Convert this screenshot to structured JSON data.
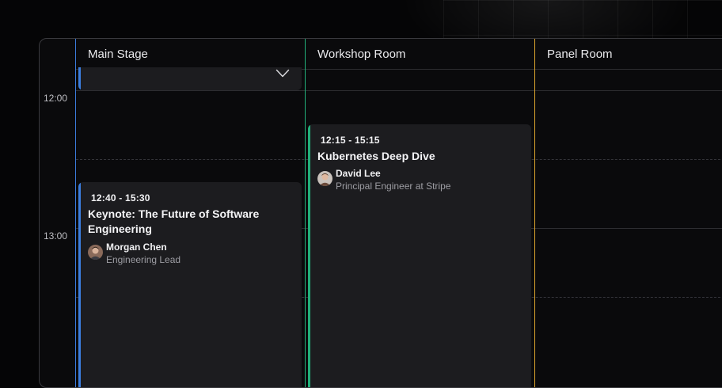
{
  "columns": [
    {
      "title": "Main Stage",
      "color": "#3b7ddd"
    },
    {
      "title": "Workshop Room",
      "color": "#22b07a"
    },
    {
      "title": "Panel Room",
      "color": "#e0a82e"
    }
  ],
  "times": [
    "12:00",
    "13:00"
  ],
  "events": [
    {
      "time": "12:40 - 15:30",
      "title_line1": "Keynote: The Future of Software",
      "title_line2": "Engineering",
      "speaker": "Morgan Chen",
      "role": "Engineering Lead"
    },
    {
      "time": "12:15 - 15:15",
      "title": "Kubernetes Deep Dive",
      "speaker": "David Lee",
      "role": "Principal Engineer at Stripe"
    }
  ],
  "icons": {
    "collapsed_card_toggle": "chevron-down-icon",
    "avatar": "person-avatar"
  }
}
